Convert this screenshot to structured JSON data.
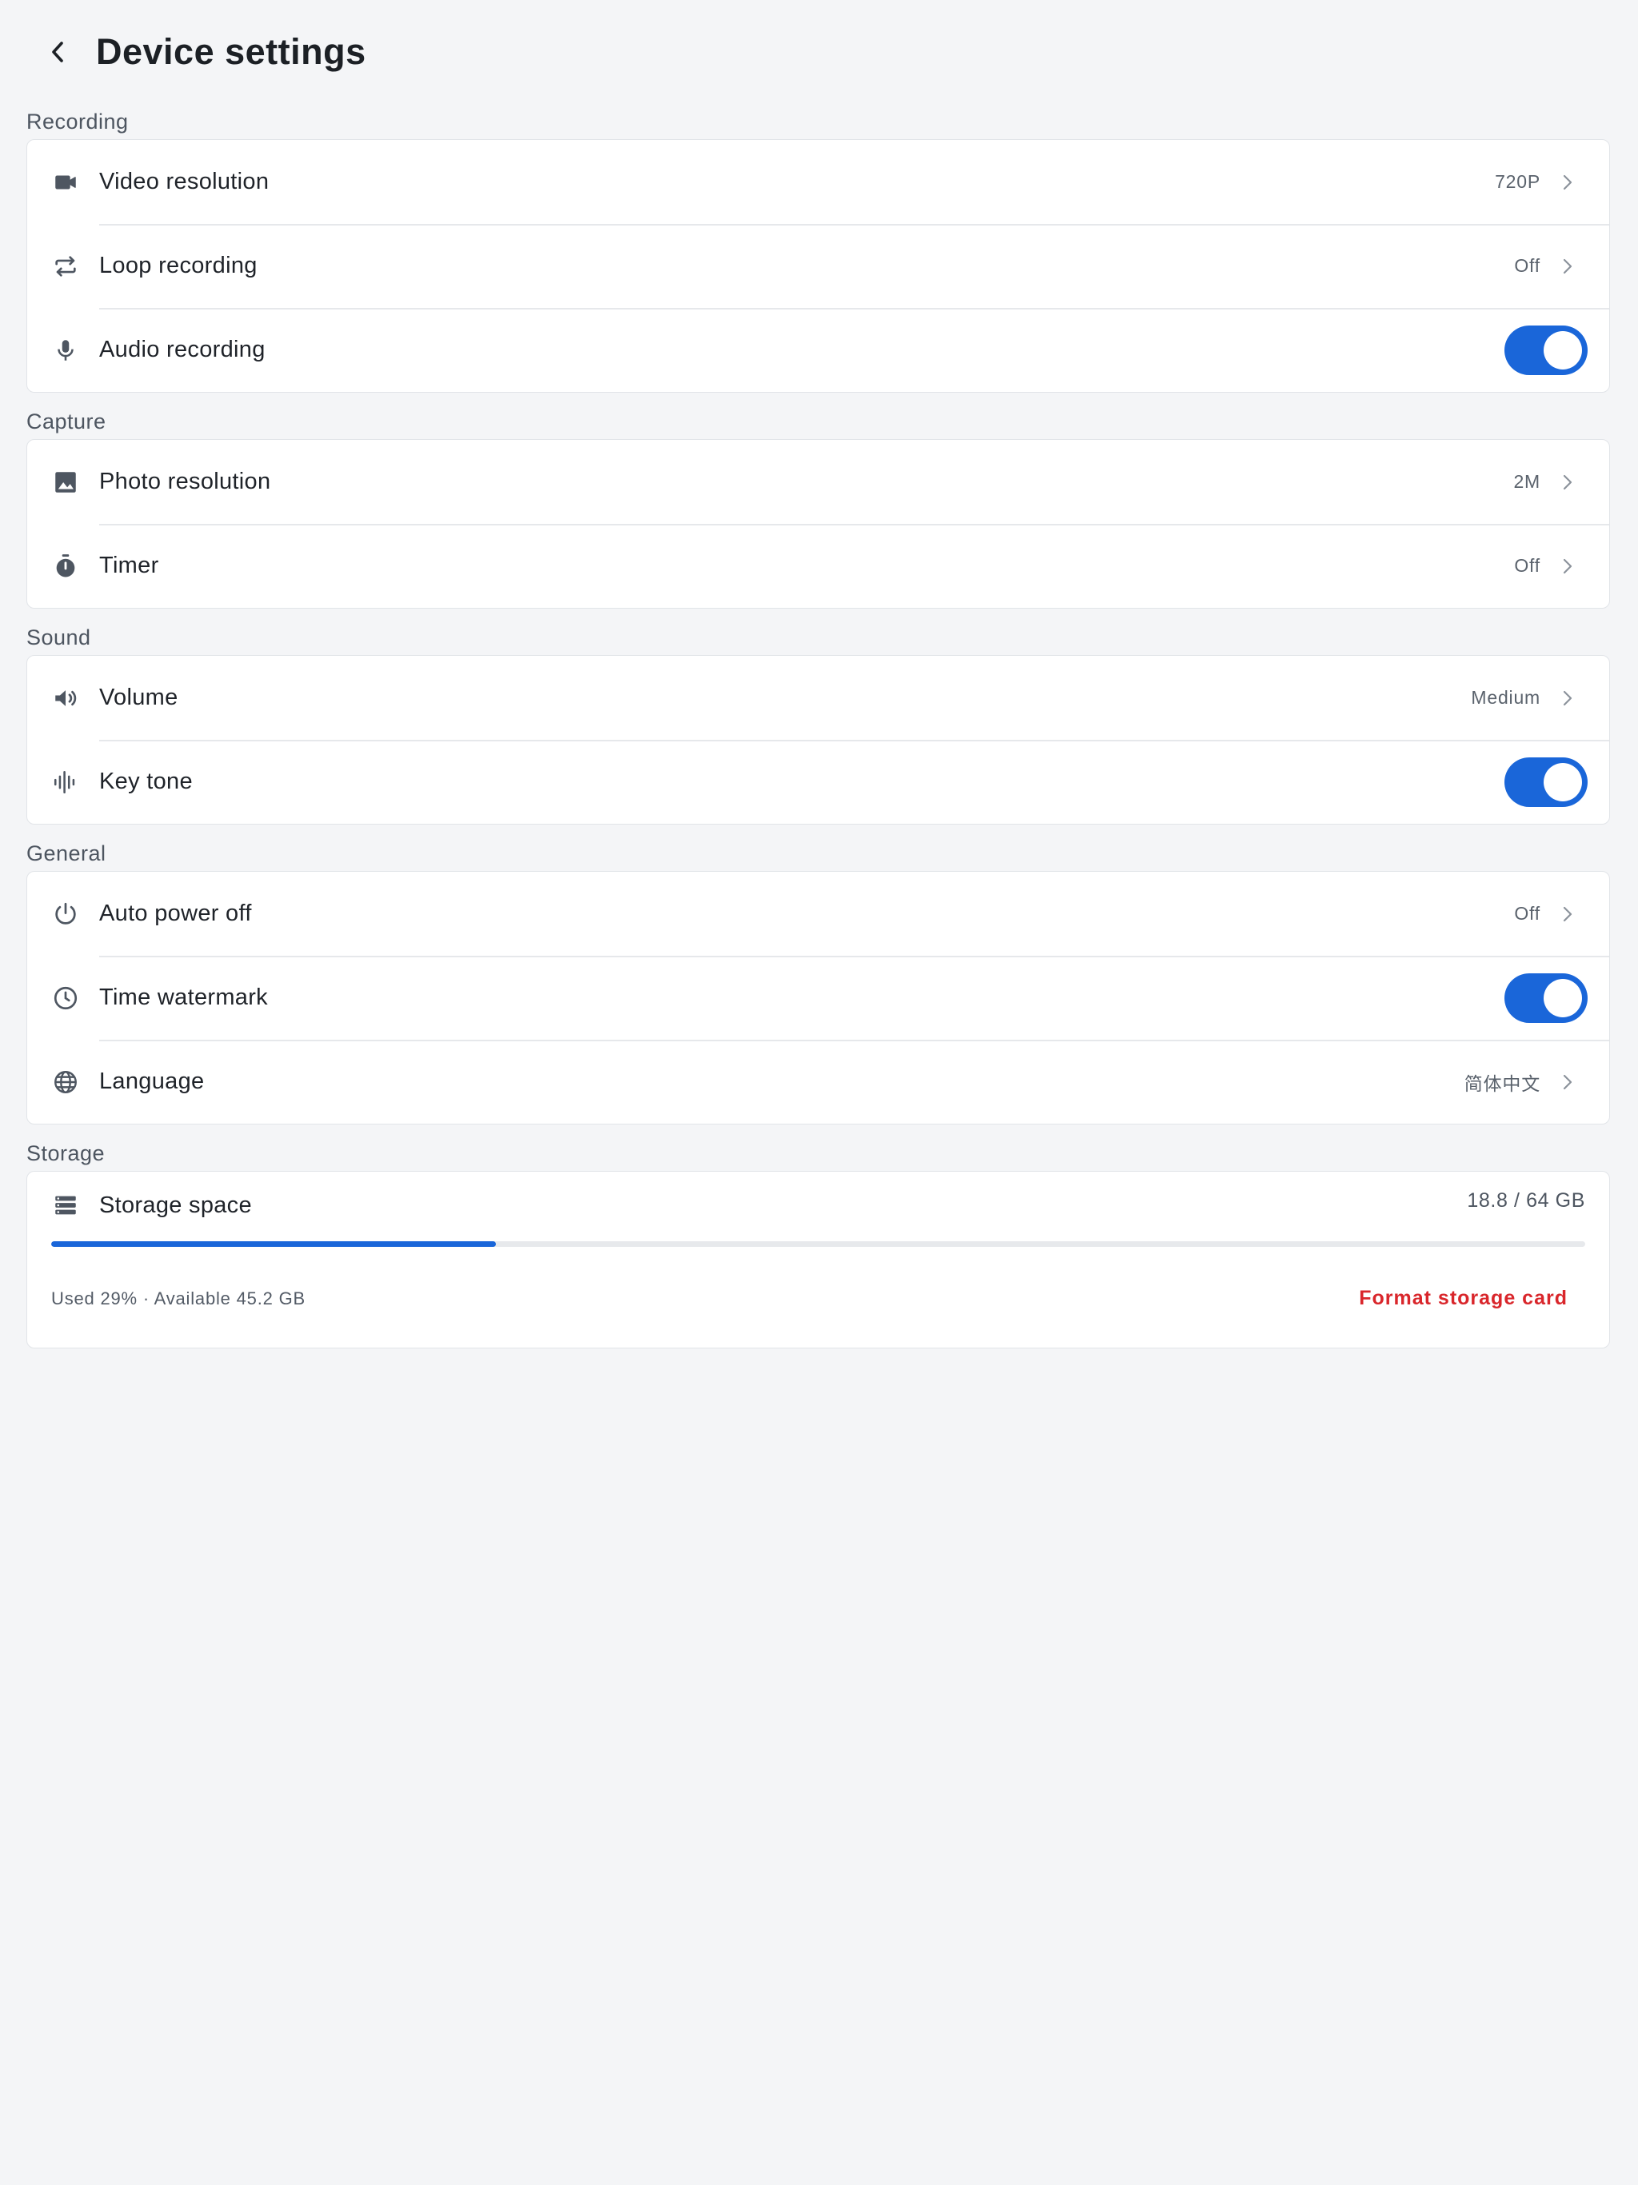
{
  "header": {
    "title": "Device settings",
    "back_icon": "chevron-left-icon"
  },
  "sections": [
    {
      "label": "Recording",
      "rows": [
        {
          "icon": "video-camera-icon",
          "label": "Video resolution",
          "value": "720P",
          "type": "nav"
        },
        {
          "icon": "loop-icon",
          "label": "Loop recording",
          "value": "Off",
          "type": "nav"
        },
        {
          "icon": "microphone-icon",
          "label": "Audio recording",
          "type": "toggle",
          "on": true
        }
      ]
    },
    {
      "label": "Capture",
      "rows": [
        {
          "icon": "image-icon",
          "label": "Photo resolution",
          "value": "2M",
          "type": "nav"
        },
        {
          "icon": "timer-icon",
          "label": "Timer",
          "value": "Off",
          "type": "nav"
        }
      ]
    },
    {
      "label": "Sound",
      "rows": [
        {
          "icon": "speaker-icon",
          "label": "Volume",
          "value": "Medium",
          "type": "nav"
        },
        {
          "icon": "waveform-icon",
          "label": "Key tone",
          "type": "toggle",
          "on": true
        }
      ]
    },
    {
      "label": "General",
      "rows": [
        {
          "icon": "power-icon",
          "label": "Auto power off",
          "value": "Off",
          "type": "nav"
        },
        {
          "icon": "clock-icon",
          "label": "Time watermark",
          "type": "toggle",
          "on": true
        },
        {
          "icon": "globe-icon",
          "label": "Language",
          "value": "简体中文",
          "type": "nav"
        }
      ]
    }
  ],
  "storage": {
    "section_label": "Storage",
    "icon": "storage-icon",
    "label": "Storage space",
    "amount": "18.8 / 64 GB",
    "used_fraction": 0.29,
    "caption": "Used 29% · Available 45.2 GB",
    "format_label": "Format storage card"
  },
  "colors": {
    "accent": "#1a66d9",
    "danger": "#d9262b",
    "background": "#f4f5f7"
  }
}
